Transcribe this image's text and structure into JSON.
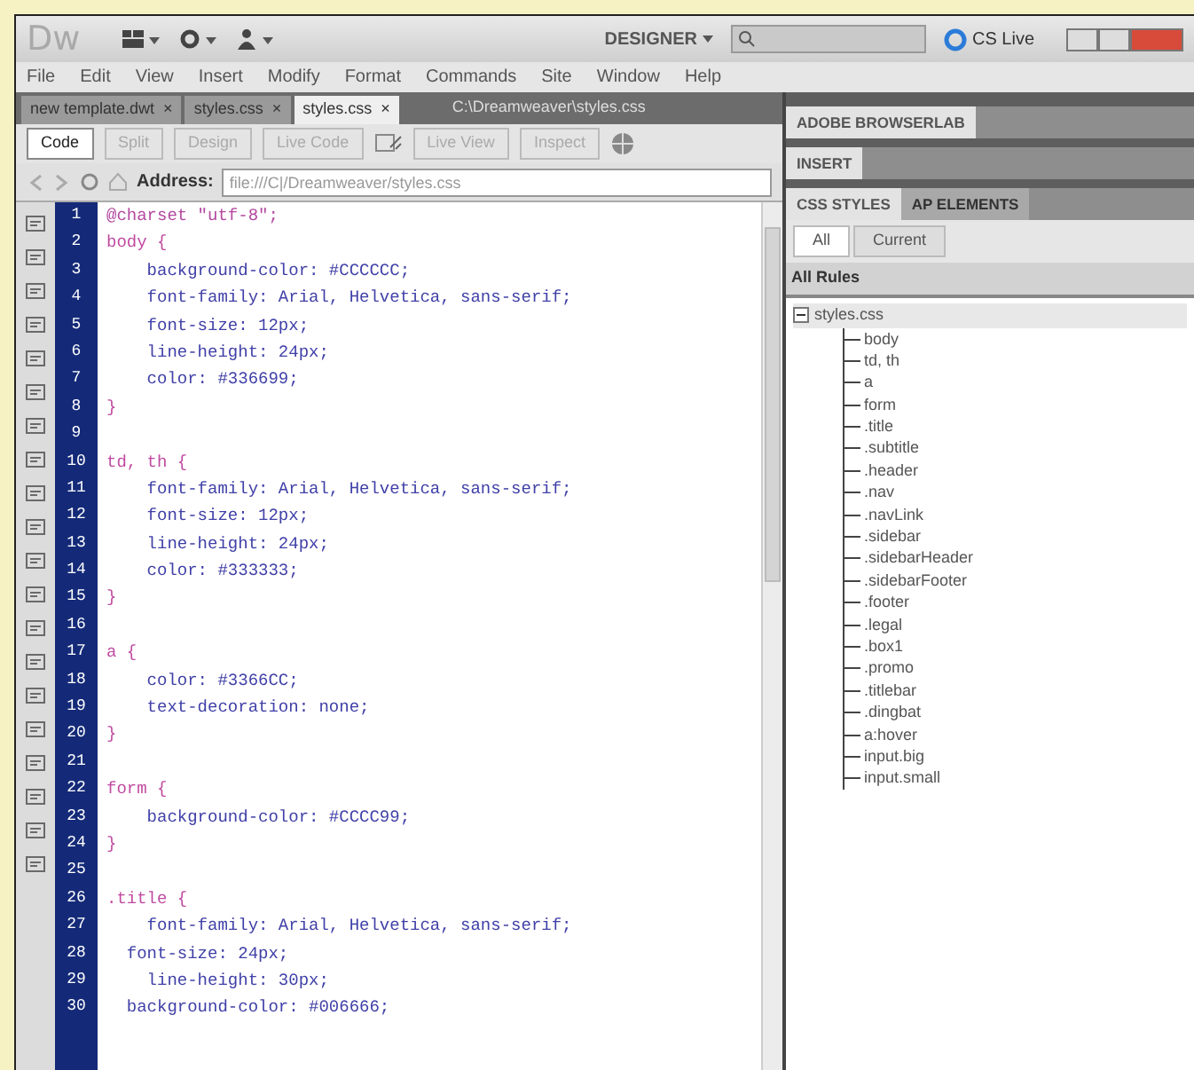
{
  "app": {
    "logo": "Dw",
    "workspace": "DESIGNER",
    "cs_live": "CS Live"
  },
  "menu": [
    "File",
    "Edit",
    "View",
    "Insert",
    "Modify",
    "Format",
    "Commands",
    "Site",
    "Window",
    "Help"
  ],
  "document_tabs": [
    {
      "label": "new template.dwt",
      "close": "×",
      "selected": false
    },
    {
      "label": "styles.css",
      "close": "×",
      "selected": false
    },
    {
      "label": "styles.css",
      "close": "×",
      "selected": true
    }
  ],
  "file_path": "C:\\Dreamweaver\\styles.css",
  "view_buttons": [
    {
      "label": "Code",
      "selected": true
    },
    {
      "label": "Split",
      "selected": false
    },
    {
      "label": "Design",
      "selected": false
    },
    {
      "label": "Live Code",
      "selected": false
    },
    {
      "label": "Live View",
      "selected": false
    },
    {
      "label": "Inspect",
      "selected": false
    }
  ],
  "address": {
    "label": "Address:",
    "value": "file:///C|/Dreamweaver/styles.css"
  },
  "code_lines": [
    {
      "number": "1",
      "text": "@charset \"utf-8\";",
      "kind": "at"
    },
    {
      "number": "2",
      "text": "body {",
      "kind": "selector"
    },
    {
      "number": "3",
      "text": "    background-color: #CCCCCC;",
      "kind": "property"
    },
    {
      "number": "4",
      "text": "    font-family: Arial, Helvetica, sans-serif;",
      "kind": "property"
    },
    {
      "number": "5",
      "text": "    font-size: 12px;",
      "kind": "property"
    },
    {
      "number": "6",
      "text": "    line-height: 24px;",
      "kind": "property"
    },
    {
      "number": "7",
      "text": "    color: #336699;",
      "kind": "property"
    },
    {
      "number": "8",
      "text": "}",
      "kind": "brace"
    },
    {
      "number": "9",
      "kind": "blank"
    },
    {
      "number": "10",
      "text": "td, th {",
      "kind": "selector"
    },
    {
      "number": "11",
      "text": "    font-family: Arial, Helvetica, sans-serif;",
      "kind": "property"
    },
    {
      "number": "12",
      "text": "    font-size: 12px;",
      "kind": "property"
    },
    {
      "number": "13",
      "text": "    line-height: 24px;",
      "kind": "property"
    },
    {
      "number": "14",
      "text": "    color: #333333;",
      "kind": "property"
    },
    {
      "number": "15",
      "text": "}",
      "kind": "brace"
    },
    {
      "number": "16",
      "kind": "blank"
    },
    {
      "number": "17",
      "text": "a {",
      "kind": "selector"
    },
    {
      "number": "18",
      "text": "    color: #3366CC;",
      "kind": "property"
    },
    {
      "number": "19",
      "text": "    text-decoration: none;",
      "kind": "property"
    },
    {
      "number": "20",
      "text": "}",
      "kind": "brace"
    },
    {
      "number": "21",
      "kind": "blank"
    },
    {
      "number": "22",
      "text": "form {",
      "kind": "selector"
    },
    {
      "number": "23",
      "text": "    background-color: #CCCC99;",
      "kind": "property"
    },
    {
      "number": "24",
      "text": "}",
      "kind": "brace"
    },
    {
      "number": "25",
      "kind": "blank"
    },
    {
      "number": "26",
      "text": ".title {",
      "kind": "selector"
    },
    {
      "number": "27",
      "text": "    font-family: Arial, Helvetica, sans-serif;",
      "kind": "property"
    },
    {
      "number": "28",
      "text": "  font-size: 24px;",
      "kind": "property"
    },
    {
      "number": "29",
      "text": "    line-height: 30px;",
      "kind": "property"
    },
    {
      "number": "30",
      "text": "  background-color: #006666;",
      "kind": "property"
    }
  ],
  "panels": [
    {
      "title": "ADOBE BROWSERLAB"
    },
    {
      "title": "INSERT"
    }
  ],
  "css_panel": {
    "tabs": [
      {
        "label": "CSS STYLES",
        "selected": true
      },
      {
        "label": "AP ELEMENTS",
        "selected": false
      }
    ],
    "modes": [
      {
        "label": "All",
        "selected": true
      },
      {
        "label": "Current",
        "selected": false
      }
    ],
    "section": "All Rules",
    "tree": {
      "label": "styles.css",
      "expanded": true,
      "children": [
        {
          "label": "body"
        },
        {
          "label": "td, th"
        },
        {
          "label": "a"
        },
        {
          "label": "form"
        },
        {
          "label": ".title"
        },
        {
          "label": ".subtitle"
        },
        {
          "label": ".header"
        },
        {
          "label": ".nav"
        },
        {
          "label": ".navLink"
        },
        {
          "label": ".sidebar"
        },
        {
          "label": ".sidebarHeader"
        },
        {
          "label": ".sidebarFooter"
        },
        {
          "label": ".footer"
        },
        {
          "label": ".legal"
        },
        {
          "label": ".box1"
        },
        {
          "label": ".promo"
        },
        {
          "label": ".titlebar"
        },
        {
          "label": ".dingbat"
        },
        {
          "label": "a:hover"
        },
        {
          "label": "input.big"
        },
        {
          "label": "input.small"
        }
      ]
    }
  }
}
